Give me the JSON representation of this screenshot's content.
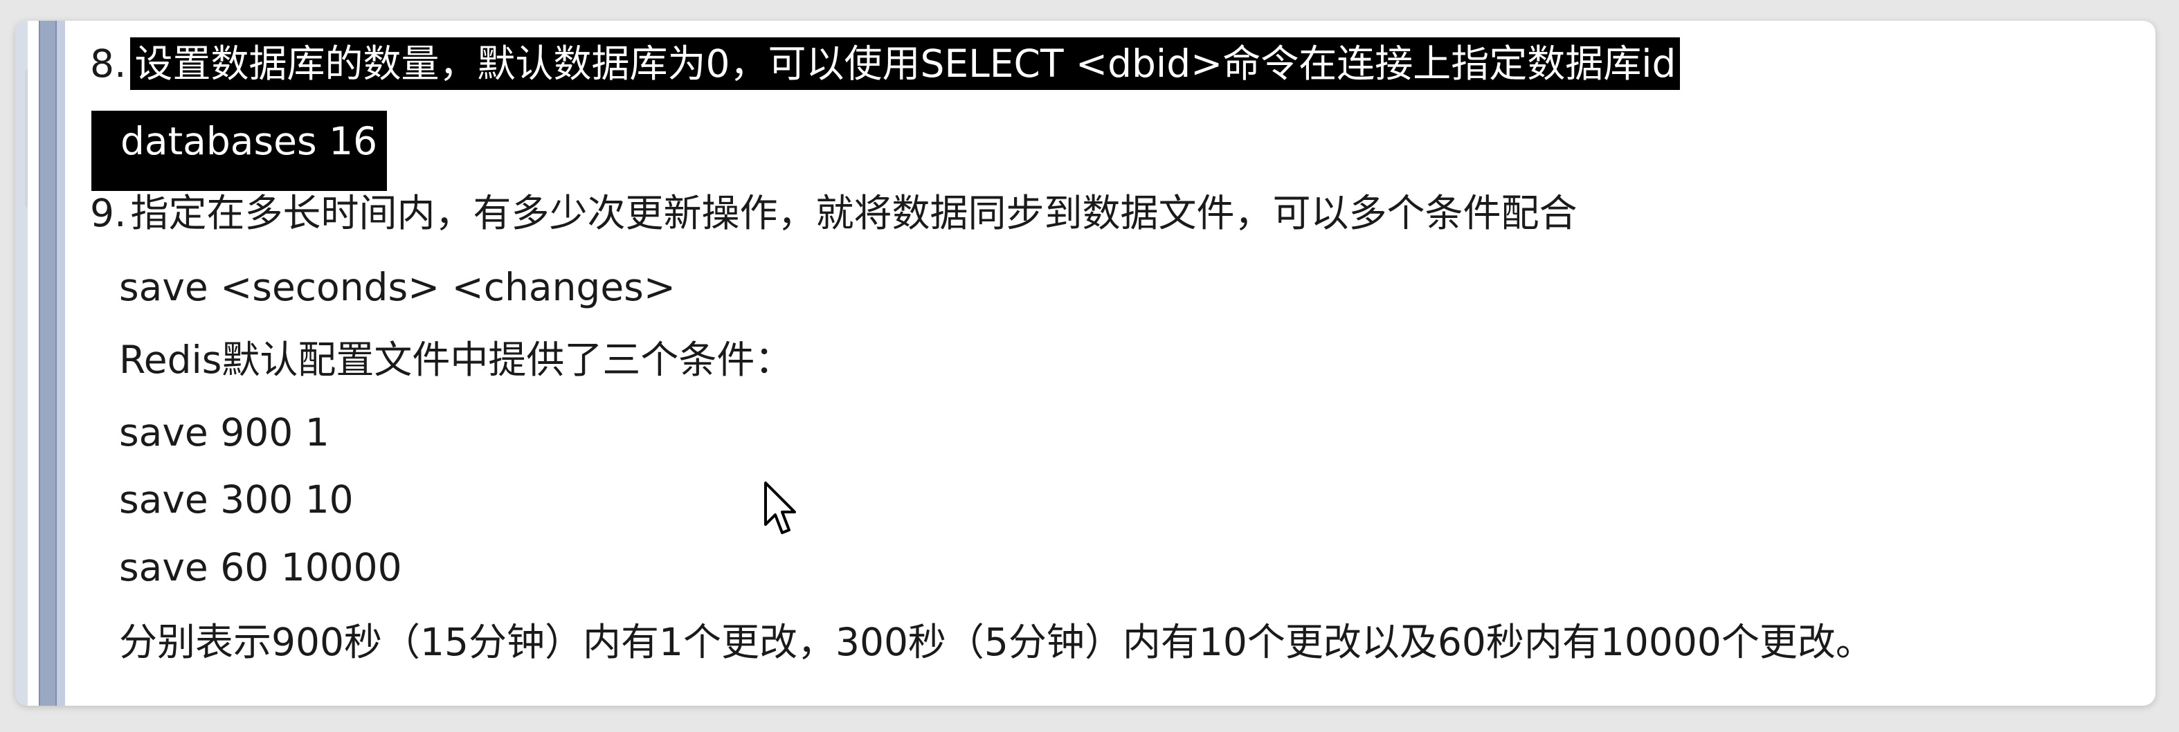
{
  "document": {
    "item8": {
      "number": "8.",
      "description": "设置数据库的数量，默认数据库为0，可以使用SELECT <dbid>命令在连接上指定数据库id",
      "config": "databases 16"
    },
    "item9": {
      "number": "9.",
      "description": "指定在多长时间内，有多少次更新操作，就将数据同步到数据文件，可以多个条件配合",
      "syntax": "save <seconds> <changes>",
      "note": "Redis默认配置文件中提供了三个条件：",
      "conditions": [
        "save 900 1",
        "save 300 10",
        "save 60 10000"
      ],
      "explanation": "分别表示900秒（15分钟）内有1个更改，300秒（5分钟）内有10个更改以及60秒内有10000个更改。"
    }
  },
  "colors": {
    "highlight_bg": "#000000",
    "highlight_fg": "#ffffff",
    "text": "#1a1a1a",
    "margin_bar": "#9aa8c4"
  },
  "icons": {
    "cursor": "mouse-pointer-icon"
  }
}
